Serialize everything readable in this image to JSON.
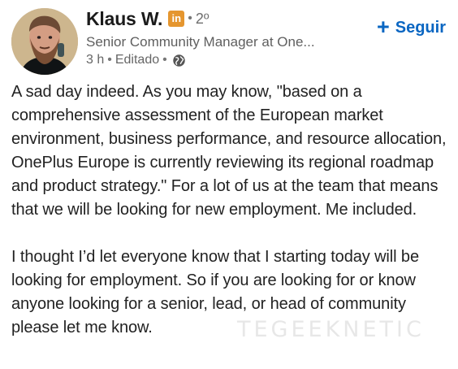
{
  "post": {
    "author": {
      "name": "Klaus W.",
      "badge": "in",
      "degree": "2º",
      "title": "Senior Community Manager at One...",
      "age": "3 h",
      "edited": "Editado"
    },
    "follow_label": "Seguir",
    "paragraphs": [
      "A sad day indeed. As you may know, \"based on a comprehensive assessment of the European market environment, business performance, and resource allocation, OnePlus Europe is currently reviewing its regional roadmap and product strategy.\"  For a lot of us at the team that means that we will be looking for new employment. Me included.",
      "I thought I’d let everyone know that I starting today will be looking for employment. So if you are looking for or know anyone looking for a senior, lead, or head of community please let me know."
    ]
  },
  "icons": {
    "avatar": "avatar-photo",
    "linkedin": "linkedin-badge-icon",
    "globe": "globe-icon",
    "plus": "plus-icon"
  },
  "colors": {
    "brand_blue": "#0a66c2",
    "badge": "#e5962f",
    "text": "#222222",
    "muted": "#666666"
  },
  "watermark": "TEGEEKNETIC"
}
